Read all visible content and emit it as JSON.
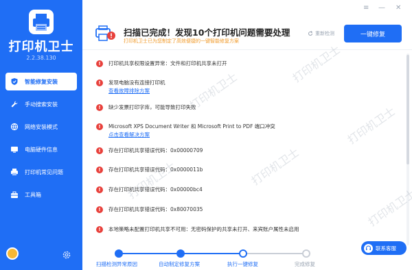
{
  "app": {
    "brand": "打印机卫士",
    "version": "2.2.38.130",
    "watermark": "打印机卫士"
  },
  "sidebar": {
    "items": [
      {
        "label": "智能修复安装",
        "icon": "shield-icon",
        "active": true
      },
      {
        "label": "手动搜索安装",
        "icon": "wrench-icon",
        "active": false
      },
      {
        "label": "网络安装模式",
        "icon": "network-icon",
        "active": false
      },
      {
        "label": "电脑硬件信息",
        "icon": "monitor-icon",
        "active": false
      },
      {
        "label": "打印机常见问题",
        "icon": "printer-icon",
        "active": false
      },
      {
        "label": "工具箱",
        "icon": "toolbox-icon",
        "active": false
      }
    ]
  },
  "window": {
    "menu": "≡",
    "minimize": "—",
    "close": "✕"
  },
  "header": {
    "title": "扫描已完成！发现10个打印机问题需要处理",
    "subtitle": "打印机卫士已为您制定了高效便捷的一键智能修复方案",
    "recheck": "重新检测",
    "fix_button": "一键修复"
  },
  "issues": [
    {
      "text": "打印机共享权限设置异常：文件和打印机共享未打开",
      "link": ""
    },
    {
      "text": "发现电脑没有连接打印机",
      "link": "查看故障排除方案"
    },
    {
      "text": "缺少发票打印字库，可能导致打印失败",
      "link": ""
    },
    {
      "text": "Microsoft XPS Document Writer 和 Microsoft Print to PDF 端口冲突",
      "link": "点击查看解决方案"
    },
    {
      "text": "存在打印机共享错误代码：0x00000709",
      "link": ""
    },
    {
      "text": "存在打印机共享错误代码：0x0000011b",
      "link": ""
    },
    {
      "text": "存在打印机共享错误代码：0x00000bc4",
      "link": ""
    },
    {
      "text": "存在打印机共享错误代码：0x80070035",
      "link": ""
    },
    {
      "text": "本地策略未配置打印机共享不可用：无密码保护的共享未打开、来宾账户属性未启用",
      "link": ""
    }
  ],
  "steps": [
    {
      "label": "扫描检测异常原因",
      "state": "done"
    },
    {
      "label": "自动制定修复方案",
      "state": "done"
    },
    {
      "label": "执行一键修复",
      "state": "current"
    },
    {
      "label": "完成修复",
      "state": "pending"
    }
  ],
  "support": {
    "label": "联系客服"
  },
  "colors": {
    "primary": "#1f6ef5",
    "error": "#e8403b",
    "warning_text": "#f09a2a",
    "pending": "#c9ced6"
  }
}
